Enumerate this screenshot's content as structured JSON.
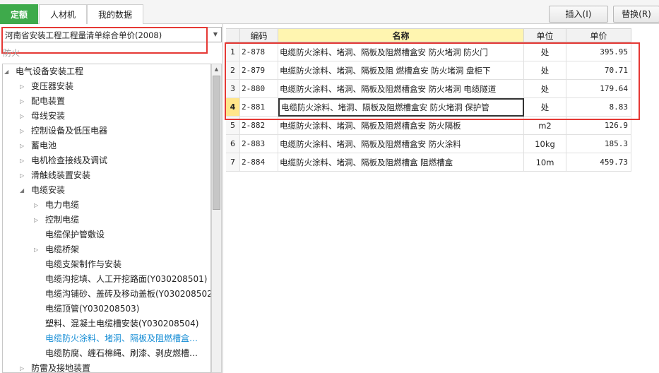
{
  "tabs": [
    {
      "label": "定额",
      "active": true
    },
    {
      "label": "人材机",
      "active": false
    },
    {
      "label": "我的数据",
      "active": false
    }
  ],
  "toolbar": {
    "insert_label": "插入(I)",
    "replace_label": "替换(R)"
  },
  "library_select": {
    "value": "河南省安装工程工程量清单综合单价(2008)"
  },
  "search": {
    "placeholder": "防火"
  },
  "tree": [
    {
      "label": "电气设备安装工程",
      "level": 0,
      "arrow": "expanded"
    },
    {
      "label": "变压器安装",
      "level": 1,
      "arrow": "collapsed"
    },
    {
      "label": "配电装置",
      "level": 1,
      "arrow": "collapsed"
    },
    {
      "label": "母线安装",
      "level": 1,
      "arrow": "collapsed"
    },
    {
      "label": "控制设备及低压电器",
      "level": 1,
      "arrow": "collapsed"
    },
    {
      "label": "蓄电池",
      "level": 1,
      "arrow": "collapsed"
    },
    {
      "label": "电机检查接线及调试",
      "level": 1,
      "arrow": "collapsed"
    },
    {
      "label": "滑触线装置安装",
      "level": 1,
      "arrow": "collapsed"
    },
    {
      "label": "电缆安装",
      "level": 1,
      "arrow": "expanded"
    },
    {
      "label": "电力电缆",
      "level": 2,
      "arrow": "collapsed"
    },
    {
      "label": "控制电缆",
      "level": 2,
      "arrow": "collapsed"
    },
    {
      "label": "电缆保护管敷设",
      "level": 2,
      "arrow": "none"
    },
    {
      "label": "电缆桥架",
      "level": 2,
      "arrow": "collapsed"
    },
    {
      "label": "电缆支架制作与安装",
      "level": 2,
      "arrow": "none"
    },
    {
      "label": "电缆沟挖填、人工开挖路面(Y030208501)",
      "level": 2,
      "arrow": "none"
    },
    {
      "label": "电缆沟铺砂、盖砖及移动盖板(Y030208502)",
      "level": 2,
      "arrow": "none"
    },
    {
      "label": "电缆顶管(Y030208503)",
      "level": 2,
      "arrow": "none"
    },
    {
      "label": "塑料、混凝土电缆槽安装(Y030208504)",
      "level": 2,
      "arrow": "none"
    },
    {
      "label": "电缆防火涂料、堵洞、隔板及阻燃槽盒…",
      "level": 2,
      "arrow": "none",
      "selected": true
    },
    {
      "label": "电缆防腐、缠石棉绳、刷漆、剥皮燃槽…",
      "level": 2,
      "arrow": "none"
    },
    {
      "label": "防雷及接地装置",
      "level": 1,
      "arrow": "collapsed"
    }
  ],
  "table": {
    "headers": {
      "num": "",
      "code": "编码",
      "name": "名称",
      "unit": "单位",
      "price": "单价"
    },
    "rows": [
      {
        "num": "1",
        "code": "2-878",
        "name": "电缆防火涂料、堵洞、隔板及阻燃槽盒安 防火堵洞 防火门",
        "unit": "处",
        "price": "395.95"
      },
      {
        "num": "2",
        "code": "2-879",
        "name": "电缆防火涂料、堵洞、隔板及阻 燃槽盒安 防火堵洞 盘柜下",
        "unit": "处",
        "price": "70.71"
      },
      {
        "num": "3",
        "code": "2-880",
        "name": "电缆防火涂料、堵洞、隔板及阻燃槽盒安 防火堵洞 电缆隧道",
        "unit": "处",
        "price": "179.64"
      },
      {
        "num": "4",
        "code": "2-881",
        "name": "电缆防火涂料、堵洞、隔板及阻燃槽盒安 防火堵洞 保护管",
        "unit": "处",
        "price": "8.83",
        "current": true
      },
      {
        "num": "5",
        "code": "2-882",
        "name": "电缆防火涂料、堵洞、隔板及阻燃槽盒安 防火隔板",
        "unit": "m2",
        "price": "126.9"
      },
      {
        "num": "6",
        "code": "2-883",
        "name": "电缆防火涂料、堵洞、隔板及阻燃槽盒安 防火涂料",
        "unit": "10kg",
        "price": "185.3"
      },
      {
        "num": "7",
        "code": "2-884",
        "name": "电缆防火涂料、堵洞、隔板及阻燃槽盒 阻燃槽盒",
        "unit": "10m",
        "price": "459.73"
      }
    ]
  },
  "colors": {
    "active_tab": "#3eaa4b",
    "highlight_box": "#e53935",
    "selected_tree_text": "#1a8fd6",
    "name_header_bg": "#fff5b0"
  }
}
